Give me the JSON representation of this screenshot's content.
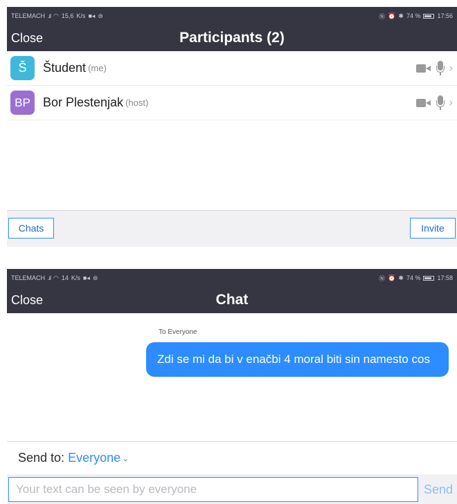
{
  "participants_screen": {
    "status": {
      "carrier": "TELEMACH",
      "speed_value": "15,6",
      "speed_unit": "K/s",
      "battery": "74 %",
      "time": "17:56"
    },
    "nav": {
      "close_label": "Close",
      "title": "Participants (2)"
    },
    "participants": [
      {
        "initials": "Š",
        "name": "Študent",
        "tag": "(me)",
        "avatar_color": "#3fb9d9"
      },
      {
        "initials": "BP",
        "name": "Bor Plestenjak",
        "tag": "(host)",
        "avatar_color": "#9b6fd1"
      }
    ],
    "footer": {
      "chats_label": "Chats",
      "invite_label": "Invite"
    }
  },
  "chat_screen": {
    "status": {
      "carrier": "TELEMACH",
      "speed_value": "14",
      "speed_unit": "K/s",
      "battery": "74 %",
      "time": "17:58"
    },
    "nav": {
      "close_label": "Close",
      "title": "Chat"
    },
    "message": {
      "to_label": "To Everyone",
      "text": "Zdi se mi da bi v enačbi 4 moral biti sin namesto cos"
    },
    "send_to": {
      "label": "Send to:",
      "value": "Everyone"
    },
    "input": {
      "placeholder": "Your text can be seen by everyone",
      "value": "",
      "send_label": "Send"
    }
  },
  "colors": {
    "nav_bg": "#363643",
    "accent": "#2d8cff",
    "bubble": "#2d8cff"
  }
}
